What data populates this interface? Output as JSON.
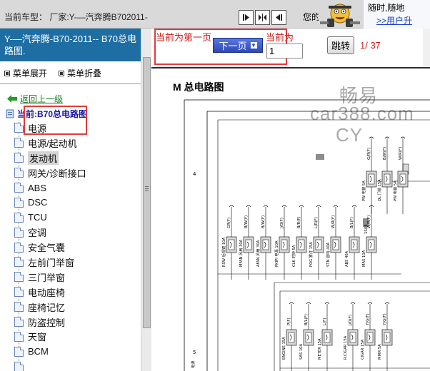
{
  "top_bar": {
    "car_model": "当前车型：  厂家:Y-—汽奔腾B702011-",
    "your_text": "您的",
    "promo_line1": "随时,随地",
    "promo_line2": ">>用户升"
  },
  "left_panel": {
    "header_title": "Y-—汽奔腾-B70-2011-- B70总电路图.",
    "expand_label": "菜单展开",
    "collapse_label": "菜单折叠",
    "back_link": "返回上一级",
    "current_node": "当前:B70总电路图",
    "items": [
      {
        "label": "电源"
      },
      {
        "label": "电源/起动机"
      },
      {
        "label": "发动机"
      },
      {
        "label": "网关/诊断接口"
      },
      {
        "label": "ABS"
      },
      {
        "label": "DSC"
      },
      {
        "label": "TCU"
      },
      {
        "label": "空调"
      },
      {
        "label": "安全气囊"
      },
      {
        "label": "左前门举窗"
      },
      {
        "label": "三门举窗"
      },
      {
        "label": "电动座椅"
      },
      {
        "label": "座椅记忆"
      },
      {
        "label": "防盗控制"
      },
      {
        "label": "天窗"
      },
      {
        "label": "BCM"
      },
      {
        "label": ""
      }
    ],
    "selected_index": 2
  },
  "toolbar": {
    "first_page_text": "当前为第一页",
    "next_button": "下一页",
    "current_label": "当前为",
    "page_value": "1",
    "jump_button": "跳转",
    "page_counter": "1/ 37"
  },
  "diagram": {
    "title": "M 总电路图",
    "watermark_1": "畅易",
    "watermark_2": "car388.com",
    "watermark_3": "CY",
    "side_numbers": [
      "4",
      "5"
    ],
    "fuse_row1": [
      "RSW 后视镜 10A",
      "MFAN 风扇 30A",
      "AFAN 风扇 30A",
      "PKIPI 电源 10A",
      "CLK 时钟 5A",
      "FOG 雾灯 15A",
      "STN 音响 40A",
      "ABS 40A",
      "MAS 10A"
    ],
    "fuse_row0": [
      "PW 电窗 5A",
      "DL 门锁 15A",
      "PW 电窗 5A"
    ],
    "fuse_row2": [
      "ENGINE 15A",
      "SAS 10A",
      "METER 15A",
      "R.CIGAR 15A",
      "CIGAR 15A",
      "MIRR 5A"
    ],
    "wire_labels_row1": [
      "GR(F)",
      "B/W(F)",
      "B/W(F)",
      "J/O(F)",
      "B/R(F)",
      "L/R(F)",
      "W/R(F)",
      "B/L(F)",
      "W/R(F)"
    ],
    "wire_labels_row0": [
      "G/R(F)",
      "B/W(F)",
      "W/R(F)"
    ],
    "wire_labels_row2": [
      "P(F)",
      "B/L(F)",
      "L(F)",
      "J/O(F)",
      "Y/G(F)"
    ],
    "connector_label": "1S08",
    "vertical_label": "电源"
  }
}
